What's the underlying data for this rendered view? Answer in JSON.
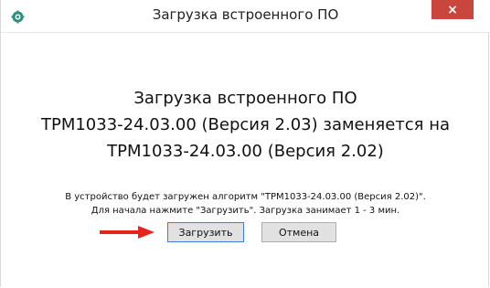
{
  "window": {
    "title": "Загрузка встроенного ПО",
    "close_glyph": "×"
  },
  "main_message": {
    "line1": "Загрузка встроенного ПО",
    "line2": "ТРМ1033-24.03.00 (Версия 2.03)  заменяется на",
    "line3": "ТРМ1033-24.03.00 (Версия 2.02)"
  },
  "info": {
    "line1": "В устройство будет загружен алгоритм \"ТРМ1033-24.03.00 (Версия 2.02)\".",
    "line2": "Для начала нажмите \"Загрузить\". Загрузка занимает 1 - 3 мин."
  },
  "buttons": {
    "load_label": "Загрузить",
    "cancel_label": "Отмена"
  },
  "colors": {
    "close_button": "#c9463d",
    "arrow": "#e8231b",
    "focus_border": "#3c7fd1"
  },
  "icons": {
    "app": "app-icon",
    "close": "close-icon",
    "arrow": "arrow-right-icon"
  }
}
